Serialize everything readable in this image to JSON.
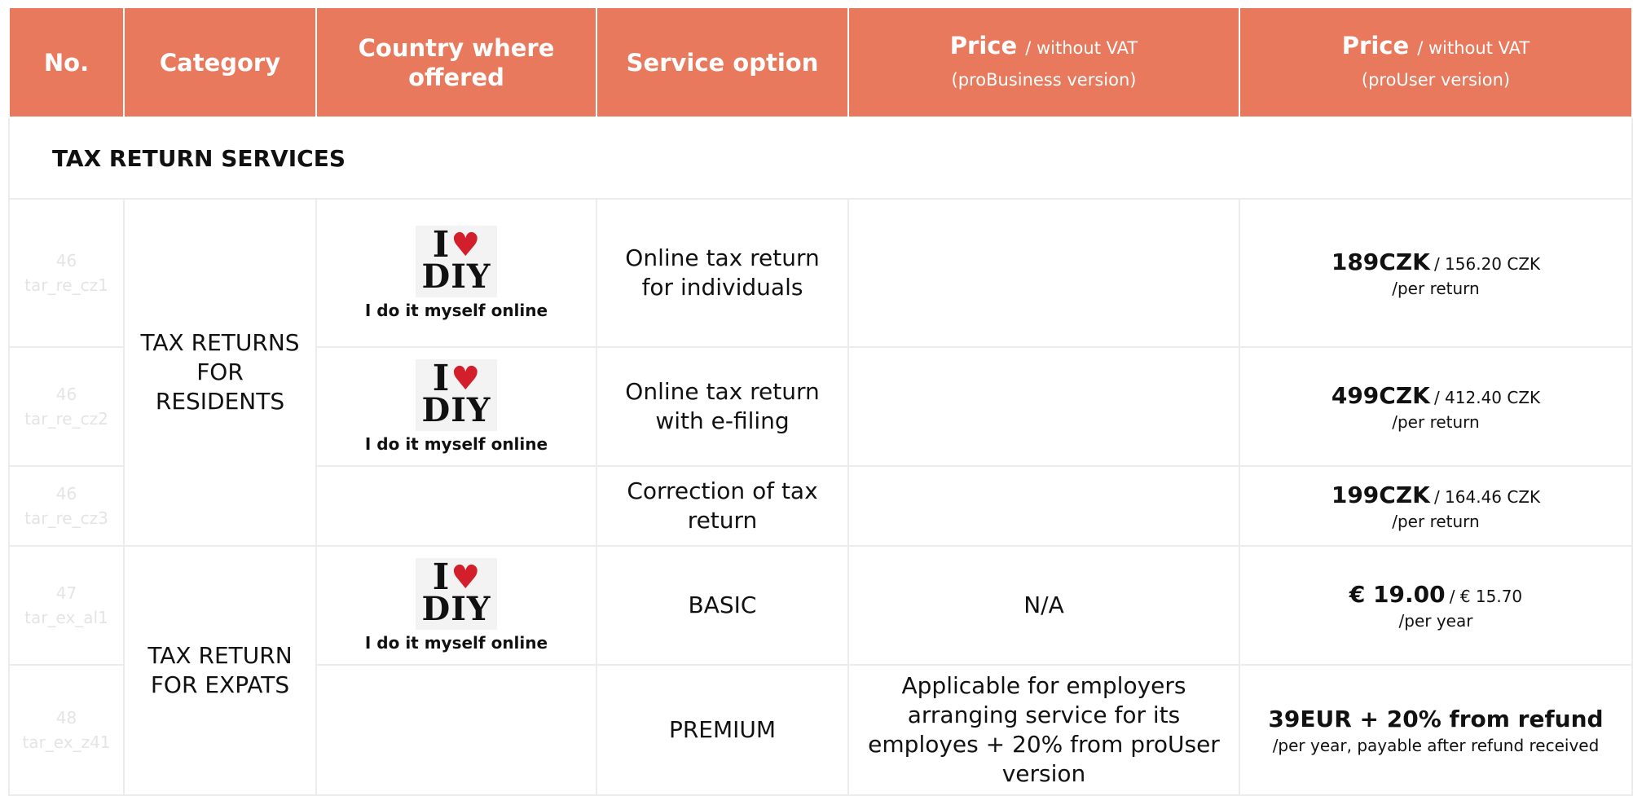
{
  "header": {
    "no": "No.",
    "category": "Category",
    "country": "Country where offered",
    "service": "Service option",
    "price_label": "Price",
    "without_vat": "/ without VAT",
    "probusiness": "(proBusiness version)",
    "prouser": "(proUser version)"
  },
  "section": {
    "title": "TAX  RETURN SERVICES"
  },
  "logo": {
    "i": "I",
    "heart": "♥",
    "diy": "DIY",
    "caption": "I do it myself online"
  },
  "rows": [
    {
      "no": "46",
      "code": "tar_re_cz1",
      "service": "Online tax return for individuals",
      "probusiness": "",
      "price_main": "189CZK",
      "price_sub": "/ 156.20 CZK",
      "price_per": "/per return"
    },
    {
      "no": "46",
      "code": "tar_re_cz2",
      "service": "Online tax return with e-filing",
      "probusiness": "",
      "price_main": "499CZK",
      "price_sub": "/ 412.40 CZK",
      "price_per": "/per return"
    },
    {
      "no": "46",
      "code": "tar_re_cz3",
      "service": "Correction of tax return",
      "probusiness": "",
      "price_main": "199CZK",
      "price_sub": "/ 164.46 CZK",
      "price_per": "/per return"
    },
    {
      "no": "47",
      "code": "tar_ex_al1",
      "service": "BASIC",
      "probusiness": "N/A",
      "price_main": "€ 19.00",
      "price_sub": "/ € 15.70",
      "price_per": "/per year"
    },
    {
      "no": "48",
      "code": "tar_ex_z41",
      "service": "PREMIUM",
      "probusiness": "Applicable for employers arranging service for its employes + 20% from proUser version",
      "price_main": "39EUR + 20% from refund",
      "price_sub": "",
      "price_per": "/per year, payable after refund received"
    }
  ],
  "categories": {
    "residents": "TAX RETURNS FOR RESIDENTS",
    "expats": "TAX RETURN FOR EXPATS"
  },
  "colors": {
    "header_bg": "#e8795c",
    "heart": "#d21f2b"
  }
}
